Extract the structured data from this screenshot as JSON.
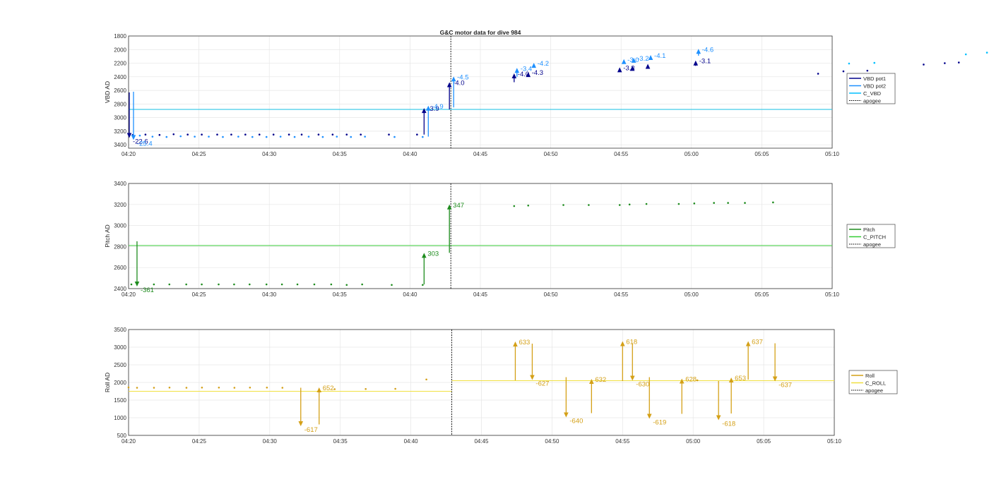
{
  "title": "G&C motor data for dive 984",
  "x_tick_labels": [
    "04:20",
    "04:25",
    "04:30",
    "04:35",
    "04:40",
    "04:45",
    "04:50",
    "04:55",
    "05:00",
    "05:05",
    "05:10"
  ],
  "apogee_time_min": 22.9,
  "chart_data": [
    {
      "type": "scatter",
      "id": "vbd",
      "ylabel": "VBD AD",
      "ylim": [
        1800,
        3450
      ],
      "yreverse": true,
      "xlim": [
        "04:20",
        "05:10"
      ],
      "grid": true,
      "legend_position": "outside-right",
      "yticks": [
        1800,
        2000,
        2200,
        2400,
        2600,
        2800,
        3000,
        3200,
        3400
      ],
      "legend": [
        {
          "label": "VBD pot1",
          "color": "#00008b",
          "style": "solid"
        },
        {
          "label": "VBD pot2",
          "color": "#1e90ff",
          "style": "solid"
        },
        {
          "label": "C_VBD",
          "color": "#00bfff",
          "style": "solid"
        },
        {
          "label": "apogee",
          "color": "#000000",
          "style": "dotted"
        }
      ],
      "reference_line": {
        "name": "C_VBD",
        "y": 2880,
        "color": "#2ec7e6"
      },
      "series": [
        {
          "name": "VBD pot1",
          "color": "#00008b",
          "x": [
            0.3,
            1.2,
            2.2,
            3.2,
            4.2,
            5.2,
            6.3,
            7.3,
            8.3,
            9.3,
            10.3,
            11.4,
            12.3,
            13.5,
            14.5,
            15.5,
            16.5,
            18.5,
            20.5,
            49,
            50.8,
            52.5,
            56.5,
            58,
            59
          ],
          "y": [
            3255,
            3250,
            3255,
            3245,
            3250,
            3250,
            3250,
            3250,
            3250,
            3250,
            3250,
            3250,
            3250,
            3250,
            3250,
            3250,
            3250,
            3250,
            3250,
            2355,
            2320,
            2310,
            2220,
            2200,
            2190
          ]
        },
        {
          "name": "VBD pot2",
          "color": "#1e90ff",
          "x": [
            0.8,
            1.7,
            2.7,
            3.7,
            4.7,
            5.7,
            6.7,
            7.8,
            8.8,
            9.8,
            10.8,
            11.8,
            12.8,
            13.8,
            14.8,
            15.8,
            16.8,
            18.9,
            20.9
          ],
          "y": [
            3265,
            3280,
            3285,
            3275,
            3280,
            3280,
            3285,
            3280,
            3285,
            3285,
            3280,
            3285,
            3280,
            3285,
            3280,
            3285,
            3280,
            3285,
            3285
          ]
        },
        {
          "name": "C_VBD",
          "color": "#00bfff",
          "x": [
            51.2,
            53,
            59.5,
            61,
            62.5,
            63.5,
            65.5
          ],
          "y": [
            2205,
            2195,
            2070,
            2045,
            2015,
            2010,
            2010
          ]
        }
      ],
      "arrows": [
        {
          "x": 0.05,
          "y_from": 2630,
          "y_to": 3300,
          "color": "#00008b",
          "label": "-22.6"
        },
        {
          "x": 0.35,
          "y_from": 2620,
          "y_to": 3330,
          "color": "#1e90ff",
          "label": "-25.4"
        },
        {
          "x": 21.0,
          "y_from": 3250,
          "y_to": 2860,
          "color": "#00008b",
          "label": "-3.9"
        },
        {
          "x": 21.3,
          "y_from": 3280,
          "y_to": 2825,
          "color": "#1e90ff",
          "label": "-4.9"
        },
        {
          "x": 22.8,
          "y_from": 2880,
          "y_to": 2480,
          "color": "#00008b",
          "label": "-4.0"
        },
        {
          "x": 23.1,
          "y_from": 2850,
          "y_to": 2395,
          "color": "#1e90ff",
          "label": "-4.5"
        },
        {
          "x": 27.4,
          "y_from": 2480,
          "y_to": 2350,
          "color": "#00008b",
          "label": "-4.0"
        },
        {
          "x": 27.6,
          "y_from": 2400,
          "y_to": 2270,
          "color": "#1e90ff",
          "label": "-3.4"
        },
        {
          "x": 28.4,
          "y_from": 2380,
          "y_to": 2330,
          "color": "#00008b",
          "label": "-4.3"
        },
        {
          "x": 28.8,
          "y_from": 2240,
          "y_to": 2195,
          "color": "#1e90ff",
          "label": "-4.2"
        },
        {
          "x": 34.9,
          "y_from": 2320,
          "y_to": 2260,
          "color": "#00008b",
          "label": "-3.3"
        },
        {
          "x": 35.2,
          "y_from": 2200,
          "y_to": 2140,
          "color": "#1e90ff",
          "label": "-3.0"
        },
        {
          "x": 35.8,
          "y_from": 2300,
          "y_to": 2240,
          "color": "#00008b",
          "label": ""
        },
        {
          "x": 35.9,
          "y_from": 2180,
          "y_to": 2120,
          "color": "#1e90ff",
          "label": "-3.2"
        },
        {
          "x": 36.9,
          "y_from": 2270,
          "y_to": 2210,
          "color": "#00008b",
          "label": ""
        },
        {
          "x": 37.1,
          "y_from": 2150,
          "y_to": 2080,
          "color": "#1e90ff",
          "label": "-4.1"
        },
        {
          "x": 40.3,
          "y_from": 2240,
          "y_to": 2160,
          "color": "#00008b",
          "label": "-3.1"
        },
        {
          "x": 40.5,
          "y_from": 2090,
          "y_to": 1990,
          "color": "#1e90ff",
          "label": "-4.6"
        }
      ]
    },
    {
      "type": "scatter",
      "id": "pitch",
      "ylabel": "Pitch AD",
      "ylim": [
        2400,
        3400
      ],
      "xlim": [
        "04:20",
        "05:10"
      ],
      "grid": true,
      "legend_position": "outside-right",
      "yticks": [
        2400,
        2600,
        2800,
        3000,
        3200,
        3400
      ],
      "legend": [
        {
          "label": "Pitch",
          "color": "#1e8c1e",
          "style": "solid"
        },
        {
          "label": "C_PITCH",
          "color": "#32cd32",
          "style": "solid"
        },
        {
          "label": "apogee",
          "color": "#000000",
          "style": "dotted"
        }
      ],
      "reference_line": {
        "name": "C_PITCH",
        "y": 2810,
        "color": "#4fd14f"
      },
      "series": [
        {
          "name": "Pitch",
          "color": "#1e8c1e",
          "x": [
            0.2,
            1.8,
            2.9,
            4.1,
            5.2,
            6.4,
            7.5,
            8.6,
            9.8,
            10.9,
            12.0,
            13.2,
            14.4,
            15.5,
            16.6,
            18.7,
            20.9,
            27.4,
            28.4,
            30.9,
            32.7,
            34.9,
            35.6,
            36.8,
            39.1,
            40.2,
            41.6,
            42.6,
            43.8,
            45.8
          ],
          "y": [
            2440,
            2440,
            2440,
            2440,
            2440,
            2440,
            2440,
            2440,
            2440,
            2440,
            2440,
            2440,
            2440,
            2435,
            2440,
            2435,
            2435,
            3185,
            3190,
            3195,
            3195,
            3195,
            3200,
            3205,
            3205,
            3210,
            3215,
            3215,
            3215,
            3220
          ]
        }
      ],
      "arrows": [
        {
          "x": 0.6,
          "y_from": 2850,
          "y_to": 2420,
          "color": "#1e8c1e",
          "label": "-361"
        },
        {
          "x": 21.0,
          "y_from": 2440,
          "y_to": 2740,
          "color": "#1e8c1e",
          "label": "303"
        },
        {
          "x": 22.8,
          "y_from": 2740,
          "y_to": 3200,
          "color": "#1e8c1e",
          "label": "347"
        }
      ]
    },
    {
      "type": "scatter",
      "id": "roll",
      "ylabel": "Roll AD",
      "ylim": [
        500,
        3500
      ],
      "xlim": [
        "04:20",
        "05:10"
      ],
      "grid": true,
      "legend_position": "outside-right",
      "yticks": [
        500,
        1000,
        1500,
        2000,
        2500,
        3000,
        3500
      ],
      "legend": [
        {
          "label": "Roll",
          "color": "#d4a017",
          "style": "solid"
        },
        {
          "label": "C_ROLL",
          "color": "#f0e040",
          "style": "solid"
        },
        {
          "label": "apogee",
          "color": "#000000",
          "style": "dotted"
        }
      ],
      "reference_steps": [
        {
          "x0": 0,
          "x1": 22.9,
          "y": 1750
        },
        {
          "x0": 22.9,
          "x1": 50,
          "y": 2050
        }
      ],
      "series": [
        {
          "name": "Roll",
          "color": "#d4a017",
          "x": [
            0,
            0.6,
            1.8,
            2.9,
            4.1,
            5.2,
            6.4,
            7.5,
            8.6,
            9.8,
            10.9,
            14.6,
            16.8,
            18.9,
            21.1,
            40.3
          ],
          "y": [
            1860,
            1850,
            1850,
            1855,
            1850,
            1855,
            1855,
            1850,
            1855,
            1855,
            1850,
            1810,
            1815,
            1820,
            2085,
            2060
          ]
        }
      ],
      "arrows": [
        {
          "x": 12.2,
          "y_from": 1850,
          "y_to": 760,
          "color": "#d4a017",
          "label": "-617"
        },
        {
          "x": 13.5,
          "y_from": 810,
          "y_to": 1860,
          "color": "#d4a017",
          "label": "652"
        },
        {
          "x": 27.4,
          "y_from": 2060,
          "y_to": 3160,
          "color": "#d4a017",
          "label": "633"
        },
        {
          "x": 28.6,
          "y_from": 3100,
          "y_to": 2070,
          "color": "#d4a017",
          "label": "-627"
        },
        {
          "x": 31.0,
          "y_from": 2150,
          "y_to": 1010,
          "color": "#d4a017",
          "label": "-640"
        },
        {
          "x": 32.8,
          "y_from": 1130,
          "y_to": 2100,
          "color": "#d4a017",
          "label": "632"
        },
        {
          "x": 35.0,
          "y_from": 2040,
          "y_to": 3170,
          "color": "#d4a017",
          "label": "618"
        },
        {
          "x": 35.7,
          "y_from": 3110,
          "y_to": 2050,
          "color": "#d4a017",
          "label": "-630"
        },
        {
          "x": 36.9,
          "y_from": 2150,
          "y_to": 970,
          "color": "#d4a017",
          "label": "-619"
        },
        {
          "x": 39.2,
          "y_from": 1110,
          "y_to": 2110,
          "color": "#d4a017",
          "label": "628"
        },
        {
          "x": 41.8,
          "y_from": 2040,
          "y_to": 930,
          "color": "#d4a017",
          "label": "-618"
        },
        {
          "x": 42.7,
          "y_from": 1120,
          "y_to": 2140,
          "color": "#d4a017",
          "label": "653"
        },
        {
          "x": 43.9,
          "y_from": 2080,
          "y_to": 3170,
          "color": "#d4a017",
          "label": "637"
        },
        {
          "x": 45.8,
          "y_from": 3110,
          "y_to": 2030,
          "color": "#d4a017",
          "label": "-637"
        }
      ]
    }
  ]
}
